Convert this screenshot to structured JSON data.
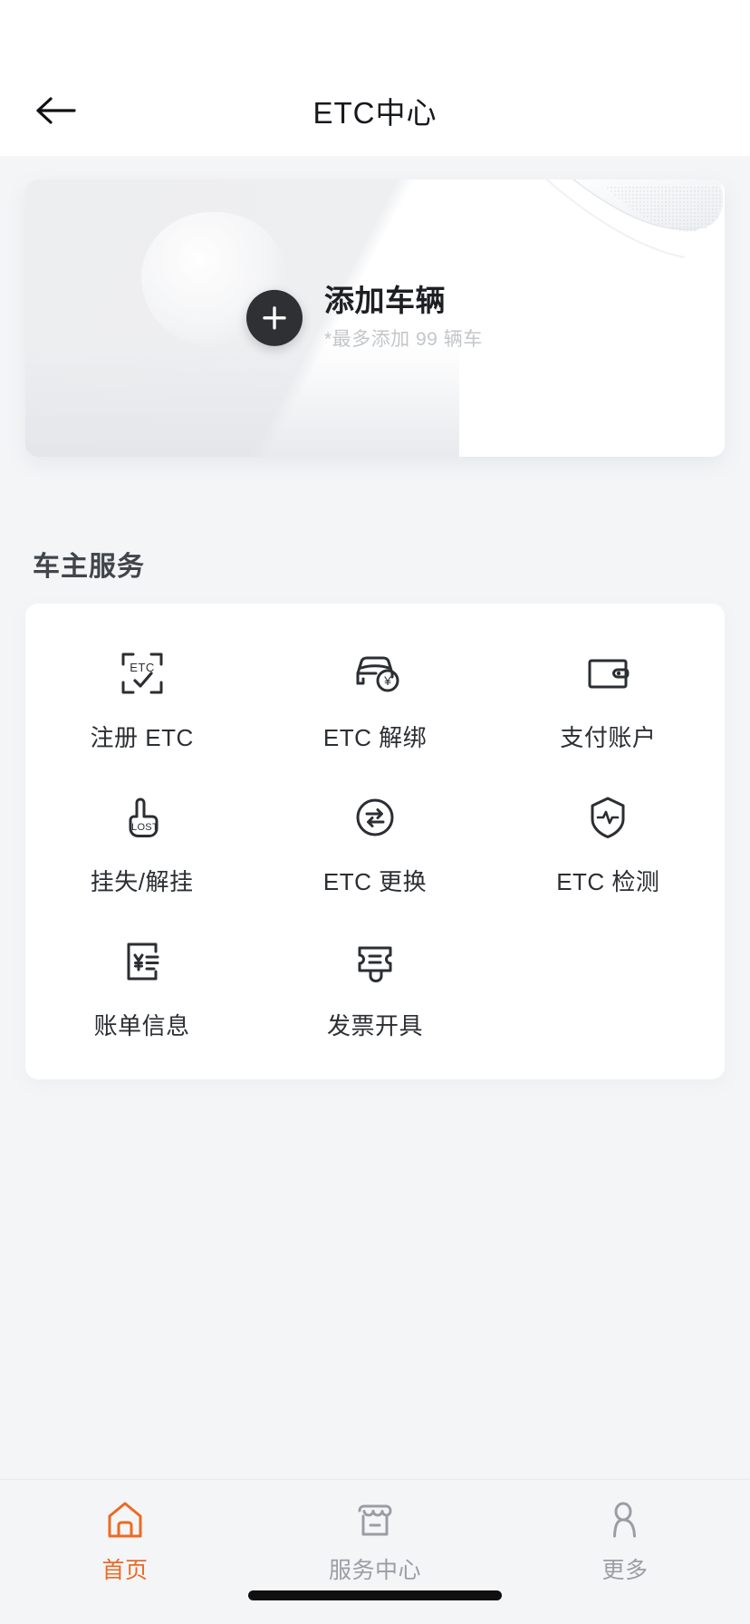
{
  "header": {
    "title": "ETC中心",
    "back_icon": "arrow-left-icon"
  },
  "vehicle_card": {
    "plus_icon": "plus-icon",
    "title": "添加车辆",
    "subtitle": "*最多添加 99 辆车"
  },
  "services": {
    "section_title": "车主服务",
    "items": [
      {
        "label": "注册 ETC",
        "icon": "scan-etc-icon"
      },
      {
        "label": "ETC 解绑",
        "icon": "car-unbind-icon"
      },
      {
        "label": "支付账户",
        "icon": "wallet-icon"
      },
      {
        "label": "挂失/解挂",
        "icon": "hand-lost-icon"
      },
      {
        "label": "ETC 更换",
        "icon": "swap-circle-icon"
      },
      {
        "label": "ETC 检测",
        "icon": "shield-pulse-icon"
      },
      {
        "label": "账单信息",
        "icon": "bill-yen-icon"
      },
      {
        "label": "发票开具",
        "icon": "invoice-icon"
      }
    ]
  },
  "tabbar": {
    "active_index": 0,
    "active_color": "#ec6a23",
    "inactive_color": "#9a9ea4",
    "items": [
      {
        "label": "首页",
        "icon": "home-icon"
      },
      {
        "label": "服务中心",
        "icon": "shop-icon"
      },
      {
        "label": "更多",
        "icon": "person-icon"
      }
    ]
  }
}
